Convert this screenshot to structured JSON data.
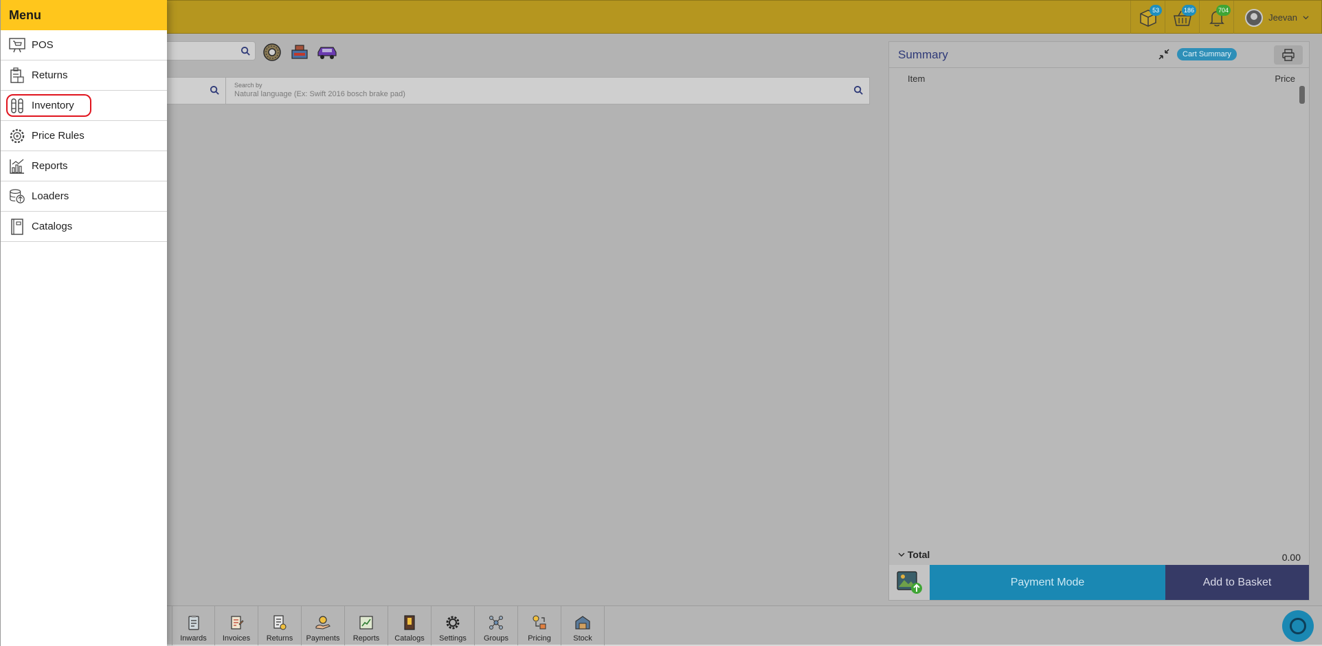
{
  "drawer": {
    "title": "Menu",
    "items": [
      {
        "label": "POS",
        "icon": "pos-icon"
      },
      {
        "label": "Returns",
        "icon": "returns-icon"
      },
      {
        "label": "Inventory",
        "icon": "inventory-icon"
      },
      {
        "label": "Price Rules",
        "icon": "price-rules-icon"
      },
      {
        "label": "Reports",
        "icon": "reports-icon"
      },
      {
        "label": "Loaders",
        "icon": "loaders-icon"
      },
      {
        "label": "Catalogs",
        "icon": "catalogs-icon"
      }
    ],
    "highlighted_item": "Inventory",
    "highlight_color": "#e0141e"
  },
  "topbar": {
    "color": "#b5961f",
    "packages_badge": "53",
    "basket_badge": "186",
    "notifications_badge": "704",
    "username": "Jeevan"
  },
  "search": {
    "label": "Search by",
    "placeholder": "Natural language (Ex: Swift 2016 bosch brake pad)"
  },
  "summary": {
    "title": "Summary",
    "cart_pill": "Cart Summary",
    "col_item": "Item",
    "col_price": "Price",
    "total_label": "Total",
    "total_value": "0.00",
    "payment_button": "Payment Mode",
    "basket_button": "Add to Basket"
  },
  "bottom_nav": [
    {
      "label": "Inwards"
    },
    {
      "label": "Invoices"
    },
    {
      "label": "Returns"
    },
    {
      "label": "Payments"
    },
    {
      "label": "Reports"
    },
    {
      "label": "Catalogs"
    },
    {
      "label": "Settings"
    },
    {
      "label": "Groups"
    },
    {
      "label": "Pricing"
    },
    {
      "label": "Stock"
    }
  ]
}
